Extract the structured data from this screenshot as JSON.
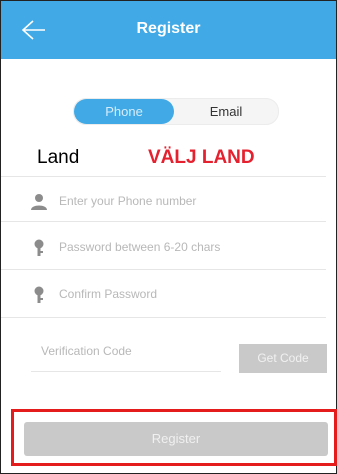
{
  "header": {
    "title": "Register",
    "back_icon": "back-arrow-icon"
  },
  "tabs": [
    {
      "label": "Phone",
      "selected": true
    },
    {
      "label": "Email",
      "selected": false
    }
  ],
  "land": {
    "label": "Land",
    "value": "VÄLJ LAND"
  },
  "fields": {
    "phone": {
      "placeholder": "Enter your Phone number",
      "icon": "person-icon"
    },
    "password": {
      "placeholder": "Password between 6-20 chars",
      "icon": "key-icon"
    },
    "confirm": {
      "placeholder": "Confirm Password",
      "icon": "key-icon"
    }
  },
  "verification": {
    "placeholder": "Verification Code",
    "button": "Get Code"
  },
  "register_button": "Register",
  "colors": {
    "accent": "#41a9e6",
    "highlight_red": "#e41c1c",
    "disabled_button": "#c9c9c9"
  }
}
